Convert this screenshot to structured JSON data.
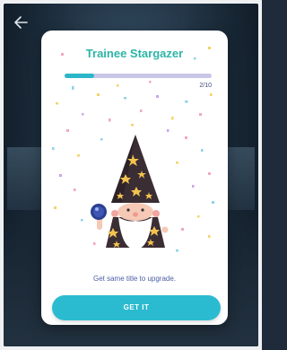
{
  "header": {
    "back_icon": "arrow-left-icon"
  },
  "dialog": {
    "title": "Trainee Stargazer",
    "progress": {
      "current": 2,
      "total": 10,
      "label": "2/10"
    },
    "illustration": "wizard-with-crystal-ball",
    "hint": "Get same title to upgrade.",
    "button_label": "GET IT"
  },
  "colors": {
    "title": "#2cb5a6",
    "accent": "#2bbbd0",
    "hint": "#4b5ea6",
    "progress_track": "#c9c7e6"
  }
}
